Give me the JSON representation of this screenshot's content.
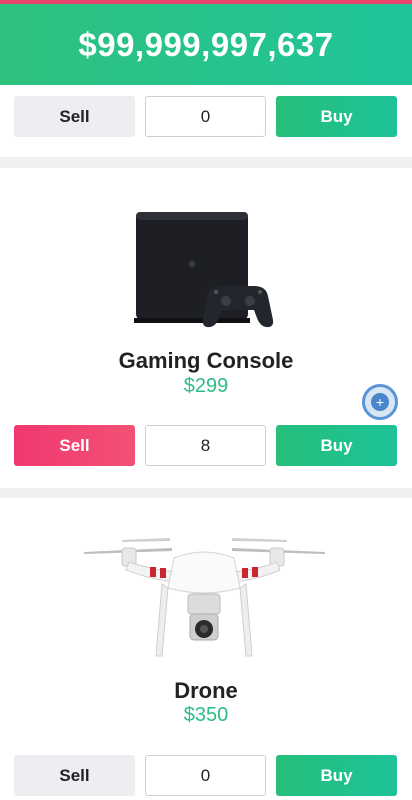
{
  "header": {
    "balance": "$99,999,997,637"
  },
  "products": [
    {
      "name": "",
      "price": "",
      "sell_label": "Sell",
      "quantity": "0",
      "buy_label": "Buy",
      "image_icon": ""
    },
    {
      "name": "Gaming Console",
      "price": "$299",
      "sell_label": "Sell",
      "quantity": "8",
      "buy_label": "Buy",
      "image_icon": "game-console-icon"
    },
    {
      "name": "Drone",
      "price": "$350",
      "sell_label": "Sell",
      "quantity": "0",
      "buy_label": "Buy",
      "image_icon": "drone-icon"
    }
  ],
  "colors": {
    "accent": "#1fc49a",
    "sell_active": "#f0386f",
    "price": "#2ebc86"
  }
}
